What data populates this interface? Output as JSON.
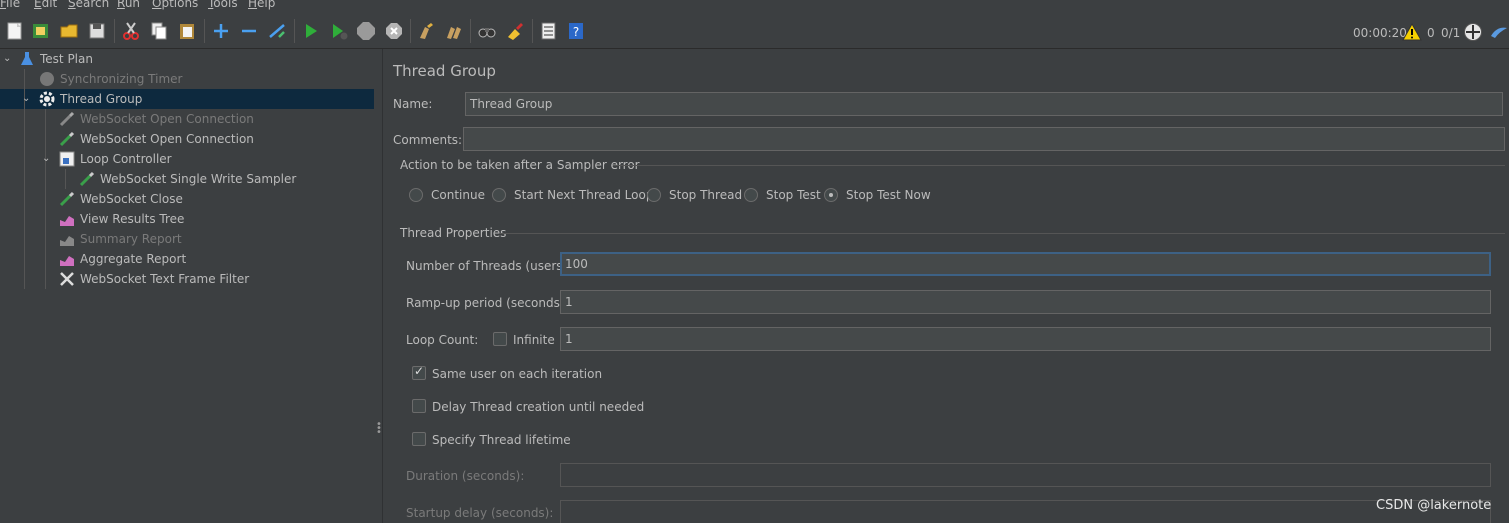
{
  "menu": [
    {
      "label": "File",
      "underline": "F",
      "rest": "ile"
    },
    {
      "label": "Edit",
      "underline": "E",
      "rest": "dit"
    },
    {
      "label": "Search",
      "underline": "S",
      "rest": "earch"
    },
    {
      "label": "Run",
      "underline": "R",
      "rest": "un"
    },
    {
      "label": "Options",
      "underline": "O",
      "rest": "ptions"
    },
    {
      "label": "Tools",
      "underline": "T",
      "rest": "ools"
    },
    {
      "label": "Help",
      "underline": "H",
      "rest": "elp"
    }
  ],
  "toolbar": {
    "icons": [
      "new-icon",
      "templates-icon",
      "open-icon",
      "save-icon",
      "cut-icon",
      "copy-icon",
      "paste-icon",
      "expand-icon",
      "collapse-icon",
      "toggle-icon",
      "start-icon",
      "start-no-pauses-icon",
      "stop-icon",
      "shutdown-icon",
      "clear-icon",
      "clear-all-icon",
      "search-icon",
      "reset-search-icon",
      "function-helper-icon",
      "help-icon"
    ],
    "elapsed": "00:00:20",
    "warning_count": "0",
    "threads": "0/1"
  },
  "tree": {
    "nodes": [
      {
        "label": "Test Plan",
        "icon": "test-plan-icon",
        "disabled": false
      },
      {
        "label": "Synchronizing Timer",
        "icon": "timer-icon",
        "disabled": true
      },
      {
        "label": "Thread Group",
        "icon": "gear-icon",
        "disabled": false,
        "selected": true
      },
      {
        "label": "WebSocket Open Connection",
        "icon": "pipette-icon",
        "disabled": true
      },
      {
        "label": "WebSocket Open Connection",
        "icon": "pipette-icon",
        "disabled": false
      },
      {
        "label": "Loop Controller",
        "icon": "loop-controller-icon",
        "disabled": false
      },
      {
        "label": "WebSocket Single Write Sampler",
        "icon": "pipette-icon",
        "disabled": false
      },
      {
        "label": "WebSocket Close",
        "icon": "pipette-icon",
        "disabled": false
      },
      {
        "label": "View Results Tree",
        "icon": "chart-icon",
        "disabled": false
      },
      {
        "label": "Summary Report",
        "icon": "chart-icon",
        "disabled": true
      },
      {
        "label": "Aggregate Report",
        "icon": "chart-icon",
        "disabled": false
      },
      {
        "label": "WebSocket Text Frame Filter",
        "icon": "tools-icon",
        "disabled": false
      }
    ]
  },
  "panel": {
    "title": "Thread Group",
    "name_label": "Name:",
    "name_value": "Thread Group",
    "comments_label": "Comments:",
    "comments_value": "",
    "error_section": "Action to be taken after a Sampler error",
    "error_options": [
      "Continue",
      "Start Next Thread Loop",
      "Stop Thread",
      "Stop Test",
      "Stop Test Now"
    ],
    "error_selected": "Stop Test Now",
    "thread_props": "Thread Properties",
    "num_threads_label": "Number of Threads (users):",
    "num_threads_value": "100",
    "rampup_label": "Ramp-up period (seconds):",
    "rampup_value": "1",
    "loop_label": "Loop Count:",
    "infinite_label": "Infinite",
    "infinite_checked": false,
    "loop_value": "1",
    "same_user_label": "Same user on each iteration",
    "same_user_checked": true,
    "delay_label": "Delay Thread creation until needed",
    "delay_checked": false,
    "lifetime_label": "Specify Thread lifetime",
    "lifetime_checked": false,
    "duration_label": "Duration (seconds):",
    "duration_value": "",
    "startup_label": "Startup delay (seconds):",
    "startup_value": ""
  },
  "watermark": "CSDN @lakernote"
}
